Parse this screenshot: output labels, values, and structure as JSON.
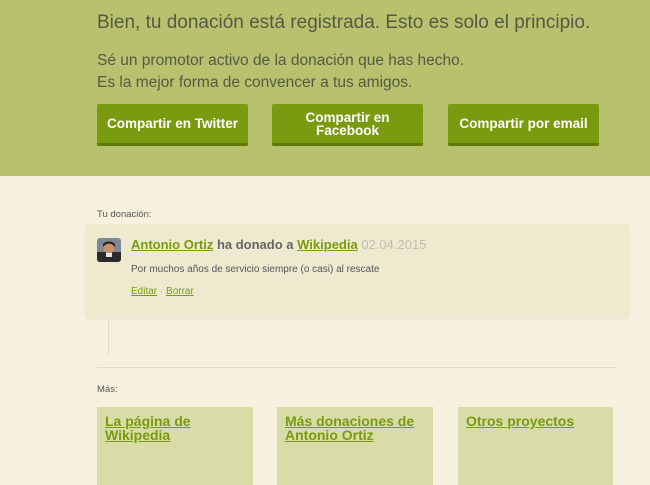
{
  "banner": {
    "title": "Bien, tu donación está registrada. Esto es solo el principio.",
    "line1": "Sé un promotor activo de la donación que has hecho.",
    "line2": "Es la mejor forma de convencer a tus amigos.",
    "buttons": [
      "Compartir en Twitter",
      "Compartir en Facebook",
      "Compartir por email"
    ],
    "background_color": "#b8c16e",
    "button_color": "#7a9a10"
  },
  "donation": {
    "section_label": "Tu donación:",
    "donor": "Antonio Ortiz",
    "verb": "ha donado a",
    "recipient": "Wikipedia",
    "date": "02.04.2015",
    "message": "Por muchos años de servicio siempre (o casi) al rescate",
    "edit_label": "Editar",
    "separator": "·",
    "delete_label": "Borrar"
  },
  "more": {
    "section_label": "Más:",
    "cards": [
      "La página de Wikipedia",
      "Más donaciones de Antonio Ortiz",
      "Otros proyectos"
    ]
  }
}
